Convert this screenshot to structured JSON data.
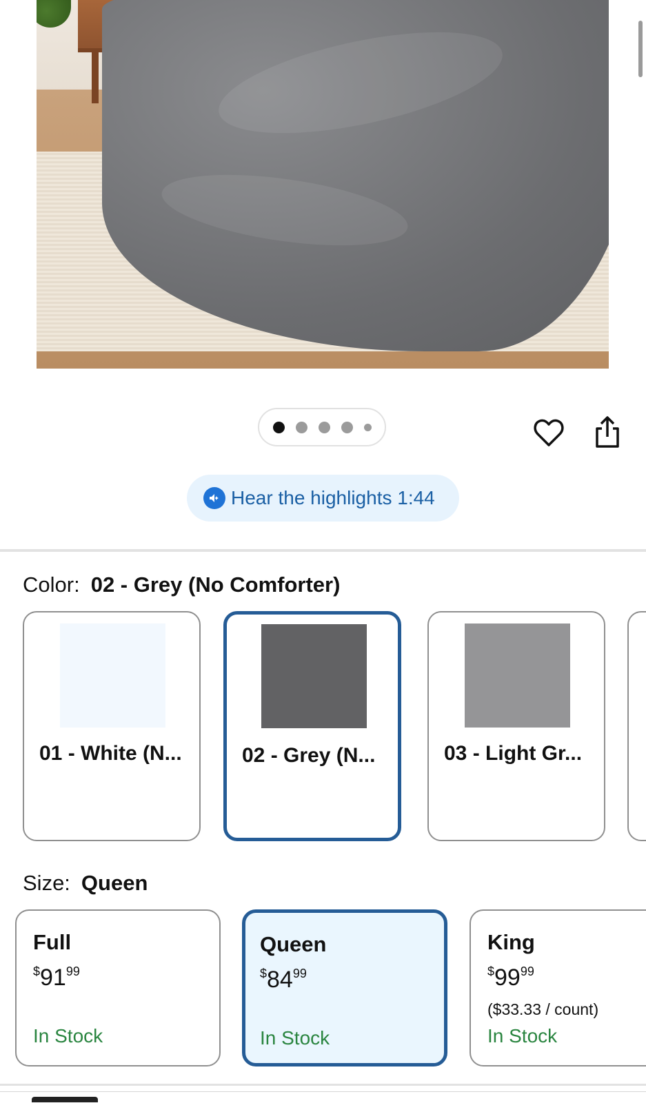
{
  "gallery": {
    "image_alt": "Grey duvet on bed",
    "dots_total": 5,
    "active_dot": 0
  },
  "actions": {
    "favorite_icon": "heart-icon",
    "share_icon": "share-icon"
  },
  "audio": {
    "icon": "audio-icon",
    "label": "Hear the highlights 1:44"
  },
  "color": {
    "label": "Color:",
    "selected": "02 - Grey (No Comforter)",
    "options": [
      {
        "name": "01 - White (N...",
        "swatch": "#f2f8fe",
        "selected": false
      },
      {
        "name": "02 - Grey (N...",
        "swatch": "#626264",
        "selected": true
      },
      {
        "name": "03 - Light Gr...",
        "swatch": "#959597",
        "selected": false
      }
    ]
  },
  "size": {
    "label": "Size:",
    "selected": "Queen",
    "options": [
      {
        "name": "Full",
        "currency": "$",
        "dollars": "91",
        "cents": "99",
        "unit_price": "",
        "stock": "In Stock",
        "selected": false
      },
      {
        "name": "Queen",
        "currency": "$",
        "dollars": "84",
        "cents": "99",
        "unit_price": "",
        "stock": "In Stock",
        "selected": true
      },
      {
        "name": "King",
        "currency": "$",
        "dollars": "99",
        "cents": "99",
        "unit_price": "($33.33 / count)",
        "stock": "In Stock",
        "selected": false
      }
    ]
  },
  "colors": {
    "accent": "#255c96",
    "stock_green": "#2a8540",
    "audio_text": "#1a5fa4",
    "audio_bg": "#e7f3fd"
  }
}
